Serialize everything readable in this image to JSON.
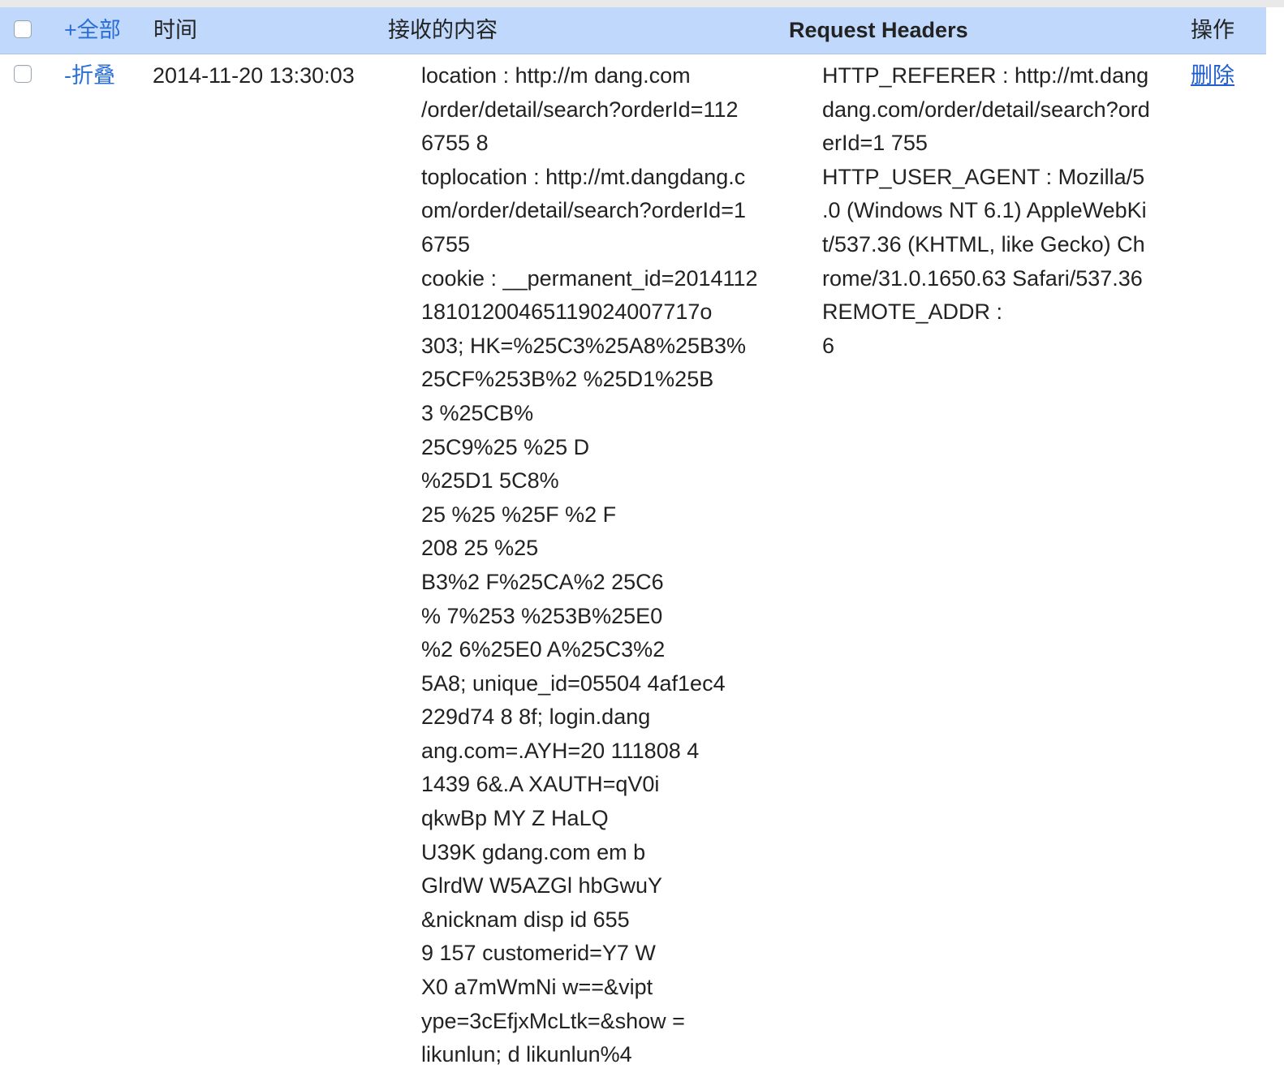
{
  "header": {
    "expand_all": "+全部",
    "col_time": "时间",
    "col_content": "接收的内容",
    "col_headers": "Request Headers",
    "col_action": "操作"
  },
  "row": {
    "collapse": "-折叠",
    "time": "2014-11-20 13:30:03",
    "content_lines": [
      "location : http://m dang.com",
      "/order/detail/search?orderId=112",
      "6755 8",
      "toplocation : http://mt.dangdang.c",
      "om/order/detail/search?orderId=1",
      "6755",
      "cookie : __permanent_id=2014112",
      "18101200465119024007717o",
      "303; HK=%25C3%25A8%25B3%",
      "25CF%253B%2 %25D1%25B",
      "3 %25CB%",
      "25C9%25 %25 D",
      "%25D1 5C8%",
      "25 %25 %25F %2 F",
      "208 25 %25",
      "B3%2 F%25CA%2 25C6",
      "% 7%253 %253B%25E0",
      "%2 6%25E0 A%25C3%2",
      "5A8; unique_id=05504 4af1ec4",
      "229d74 8 8f; login.dang",
      "ang.com=.AYH=20 111808 4",
      "1439 6&.A XAUTH=qV0i",
      "qkwBp MY Z HaLQ",
      "U39K gdang.com em b",
      "GlrdW W5AZGl hbGwuY",
      "&nicknam disp id 655",
      "9 157 customerid=Y7 W",
      "X0 a7mWmNi w==&vipt",
      "ype=3cEfjxMcLtk=&show =",
      "likunlun; d likunlun%4"
    ],
    "headers_lines": [
      "HTTP_REFERER : http://mt.dang",
      "dang.com/order/detail/search?ord",
      "erId=1 755",
      "HTTP_USER_AGENT : Mozilla/5",
      ".0 (Windows NT 6.1) AppleWebKi",
      "t/537.36 (KHTML, like Gecko) Ch",
      "rome/31.0.1650.63 Safari/537.36",
      "REMOTE_ADDR :",
      "6"
    ],
    "action_delete": "删除"
  },
  "colors": {
    "header_bg": "#c0d8fb",
    "link": "#2a6fd6"
  }
}
